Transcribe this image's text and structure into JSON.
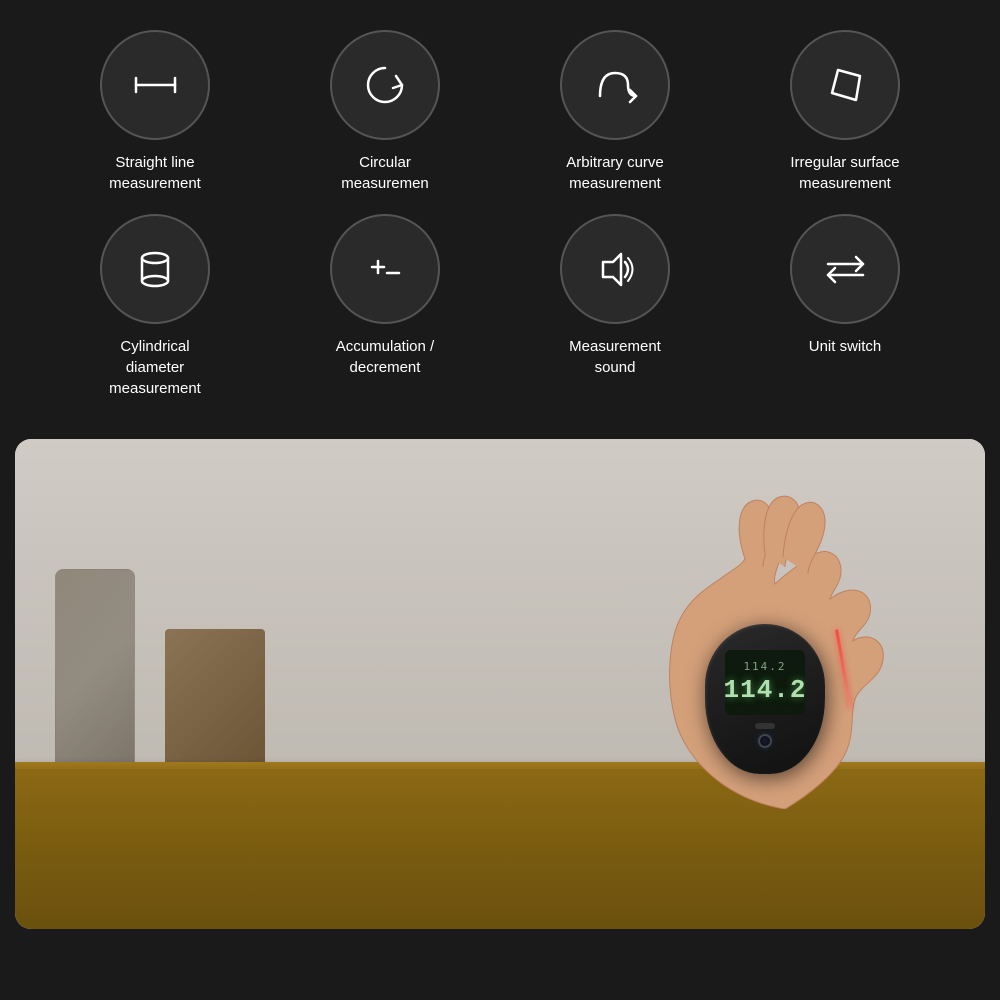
{
  "features": {
    "row1": [
      {
        "id": "straight-line",
        "label": "Straight line\nmeasurement",
        "icon": "ruler"
      },
      {
        "id": "circular",
        "label": "Circular\nmeasuremen",
        "icon": "circle-arrow"
      },
      {
        "id": "arbitrary-curve",
        "label": "Arbitrary curve\nmeasurement",
        "icon": "curve"
      },
      {
        "id": "irregular-surface",
        "label": "Irregular surface\nmeasurement",
        "icon": "polygon"
      }
    ],
    "row2": [
      {
        "id": "cylindrical",
        "label": "Cylindrical\ndiameter\nmeasurement",
        "icon": "cylinder"
      },
      {
        "id": "accumulation",
        "label": "Accumulation /\ndecrement",
        "icon": "plus-minus"
      },
      {
        "id": "measurement-sound",
        "label": "Measurement\nsound",
        "icon": "speaker"
      },
      {
        "id": "unit-switch",
        "label": "Unit switch",
        "icon": "arrows"
      }
    ]
  },
  "device": {
    "display_top": "114.2",
    "display_main": "114.2"
  },
  "colors": {
    "background": "#1a1a1a",
    "circle_border": "#555555",
    "circle_bg": "#2a2a2a",
    "text": "#ffffff",
    "accent": "#333333"
  }
}
